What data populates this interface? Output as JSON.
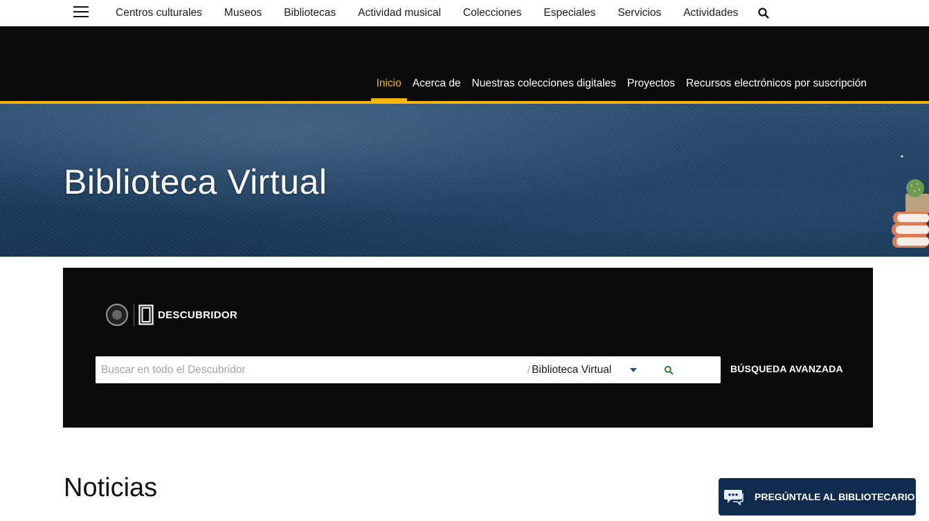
{
  "topnav": {
    "menu_icon": "hamburger-menu-icon",
    "items": [
      {
        "label": "Centros culturales"
      },
      {
        "label": "Museos"
      },
      {
        "label": "Bibliotecas"
      },
      {
        "label": "Actividad musical"
      },
      {
        "label": "Colecciones"
      },
      {
        "label": "Especiales"
      },
      {
        "label": "Servicios"
      },
      {
        "label": "Actividades"
      }
    ],
    "search_icon": "search-icon"
  },
  "section_nav": {
    "active": "Inicio",
    "items": [
      {
        "label": "Inicio"
      },
      {
        "label": "Acerca de"
      },
      {
        "label": "Nuestras colecciones digitales"
      },
      {
        "label": "Proyectos"
      },
      {
        "label": "Recursos electrónicos por suscripción"
      }
    ],
    "accent_color": "#f7b500"
  },
  "hero": {
    "title": "Biblioteca Virtual"
  },
  "discovery": {
    "brand_text": "DESCUBRIDOR",
    "search": {
      "placeholder": "Buscar en todo el Descubridor",
      "value": "",
      "scope_separator": "/",
      "scope_selected": "Biblioteca Virtual"
    },
    "advanced_label": "BÚSQUEDA AVANZADA"
  },
  "news": {
    "title": "Noticias"
  },
  "ask_librarian": {
    "label": "PREGÚNTALE AL BIBLIOTECARIO",
    "icon": "chat-bubbles-icon",
    "bg_color": "#0f2b4e"
  }
}
